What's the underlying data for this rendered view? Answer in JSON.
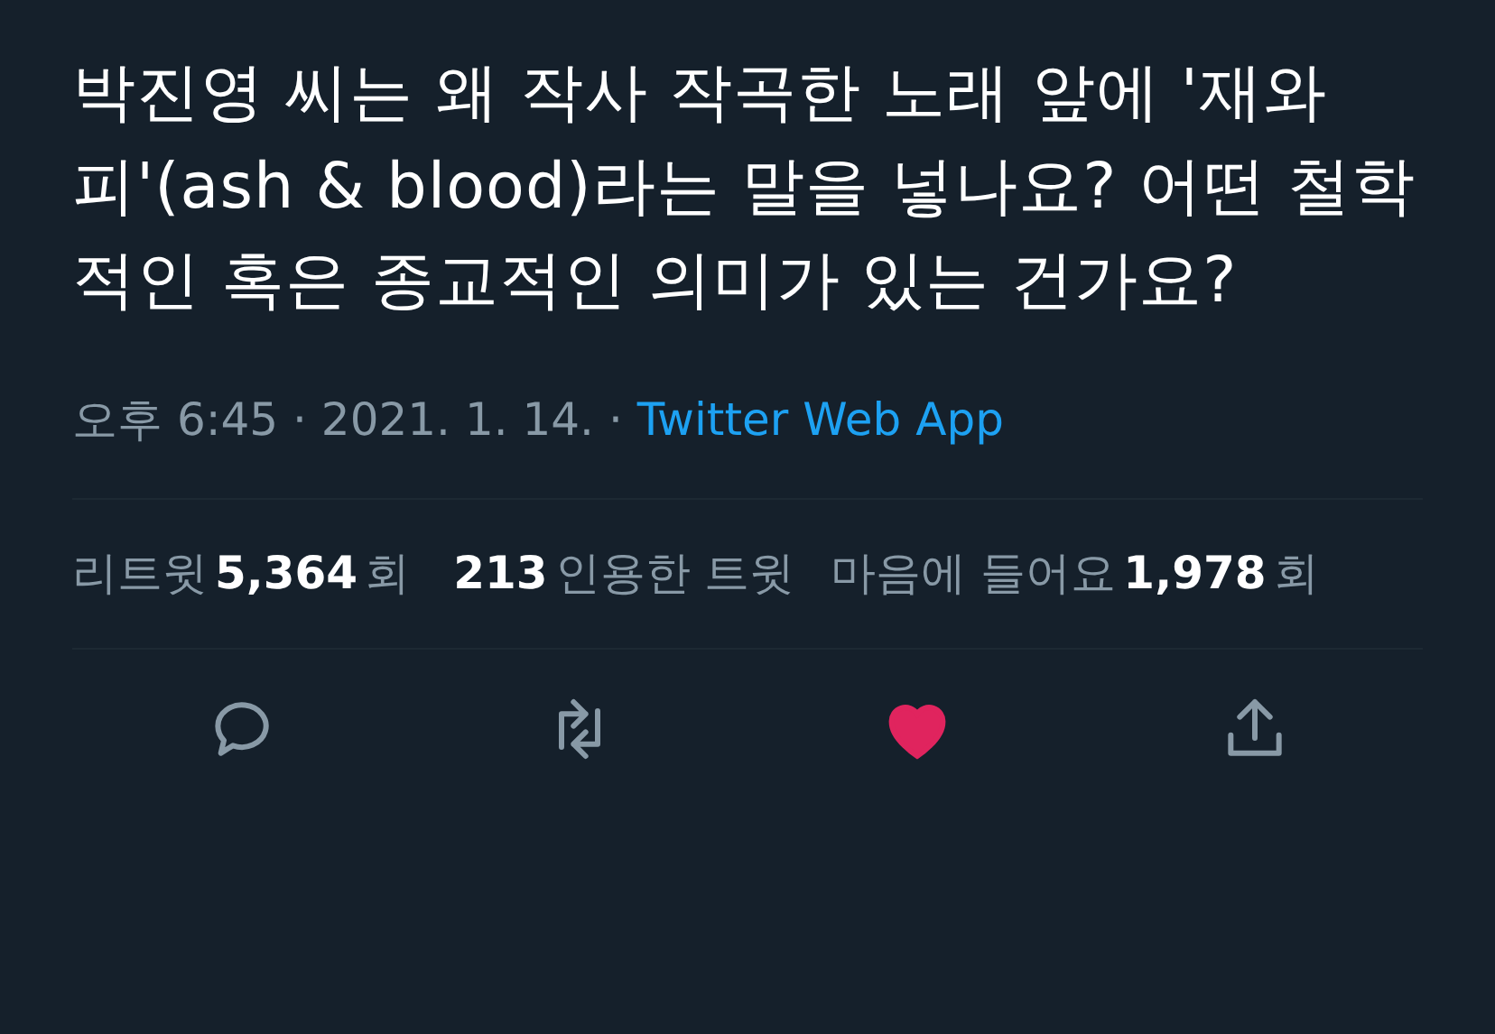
{
  "tweet": {
    "text": "박진영 씨는 왜 작사 작곡한 노래 앞에 '재와 피'(ash & blood)라는 말을 넣나요? 어떤 철학적인 혹은 종교적인 의미가 있는 건가요?"
  },
  "meta": {
    "time": "오후 6:45 · 2021. 1. 14. ·",
    "source": "Twitter Web App"
  },
  "stats": [
    {
      "prefix": "리트윗",
      "count": "5,364",
      "suffix": "회"
    },
    {
      "count": "213",
      "suffix": "인용한 트윗"
    },
    {
      "prefix": "마음에 들어요",
      "count": "1,978",
      "suffix": "회"
    }
  ],
  "actions": [
    {
      "kind": "reply",
      "selected": false
    },
    {
      "kind": "retweet",
      "selected": false
    },
    {
      "kind": "like",
      "selected": true
    },
    {
      "kind": "share",
      "selected": false
    }
  ]
}
